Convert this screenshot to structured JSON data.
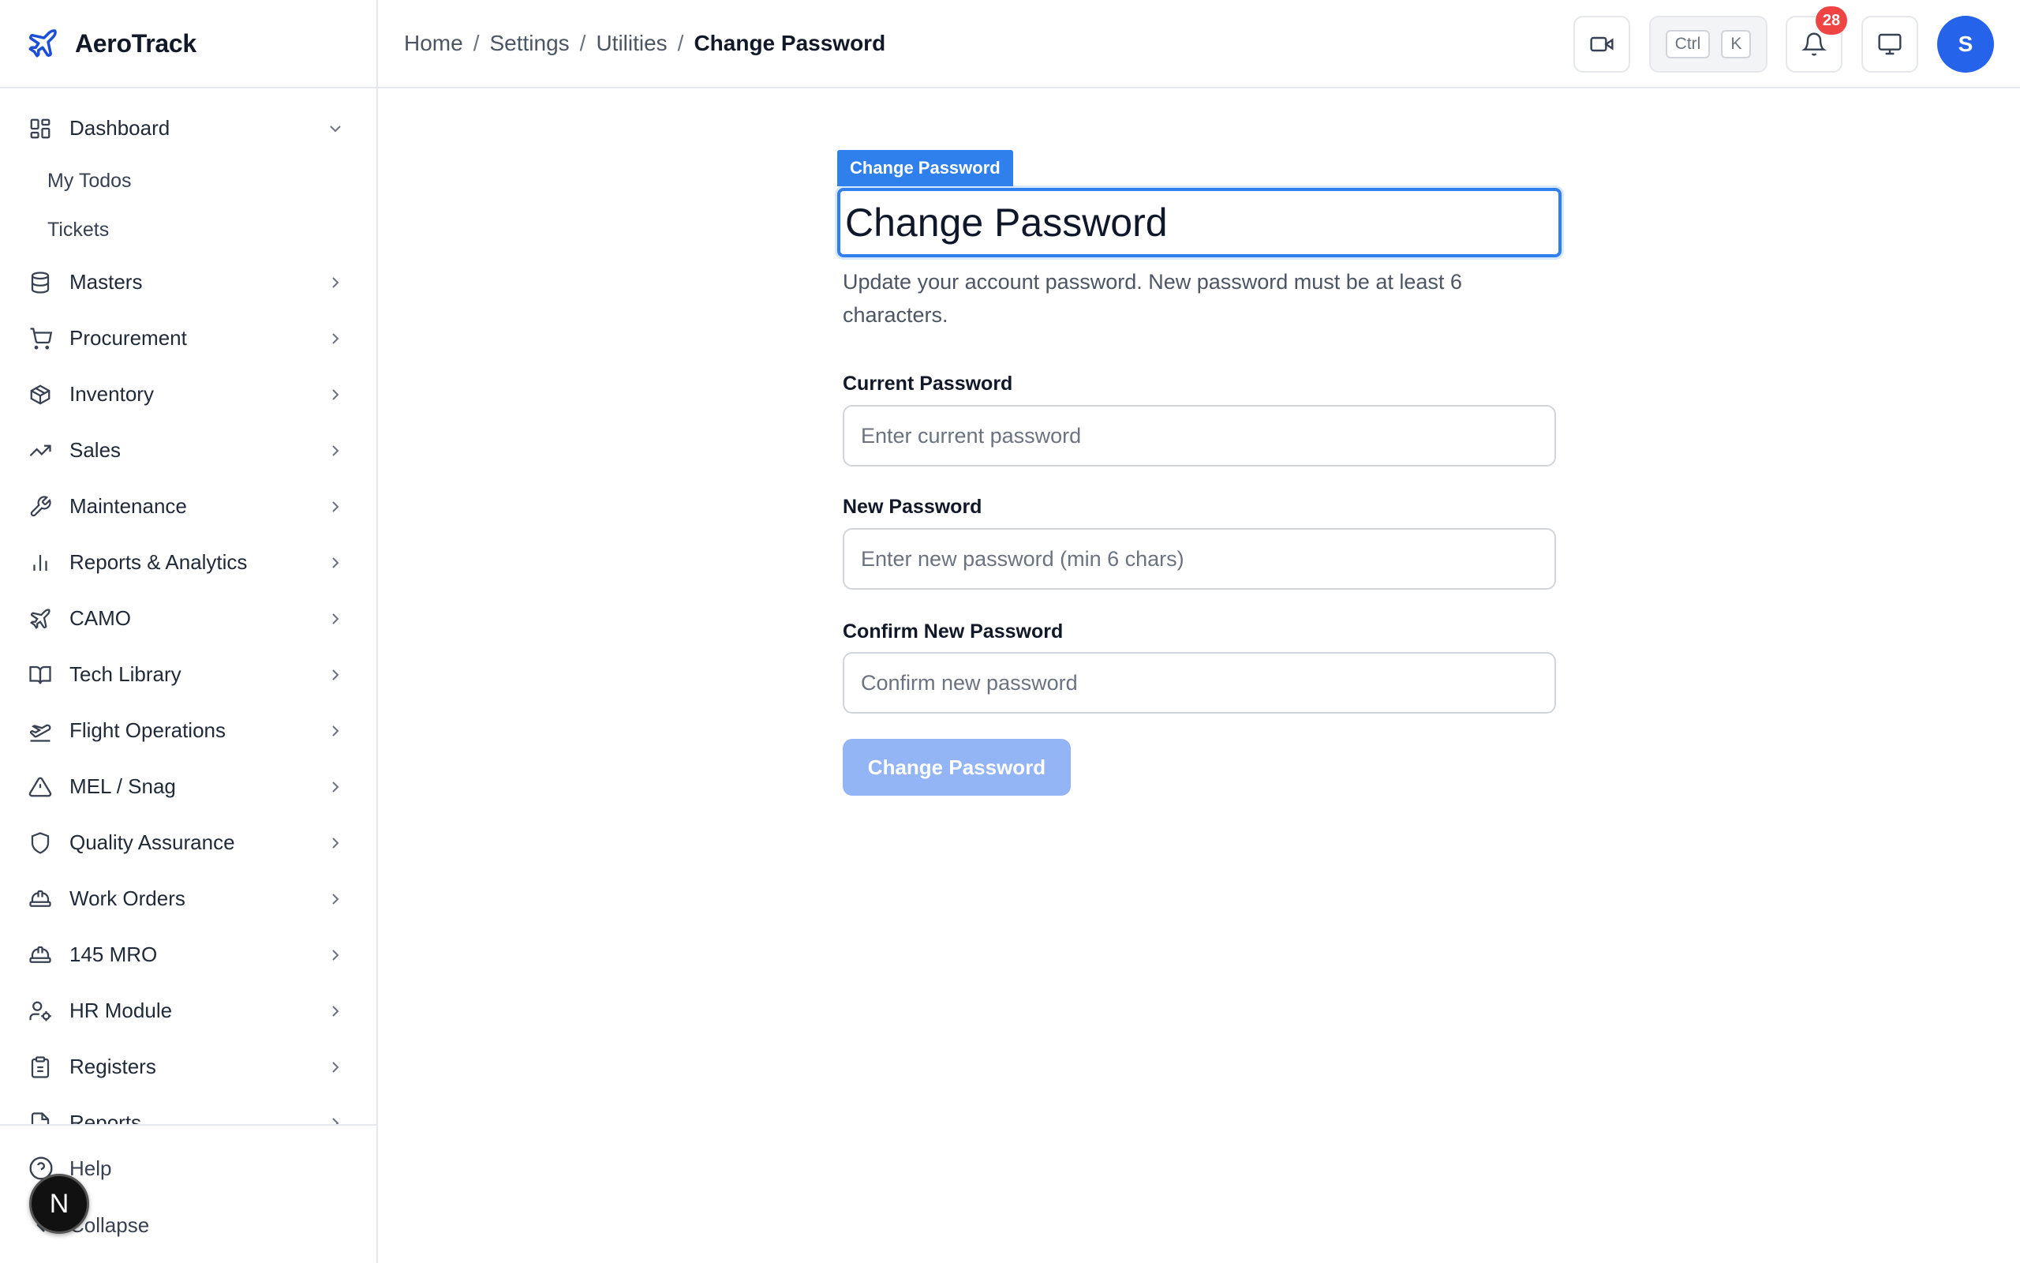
{
  "app": {
    "name": "AeroTrack",
    "accent_color": "#2f80ed",
    "brand_color": "#1d4ed8"
  },
  "sidebar": {
    "dashboard": {
      "label": "Dashboard",
      "icon": "dashboard-grid-icon",
      "expanded": true,
      "children": [
        {
          "label": "My Todos"
        },
        {
          "label": "Tickets"
        }
      ]
    },
    "items": [
      {
        "label": "Masters",
        "icon": "database-icon"
      },
      {
        "label": "Procurement",
        "icon": "cart-icon"
      },
      {
        "label": "Inventory",
        "icon": "package-icon"
      },
      {
        "label": "Sales",
        "icon": "trending-up-icon"
      },
      {
        "label": "Maintenance",
        "icon": "wrench-icon"
      },
      {
        "label": "Reports & Analytics",
        "icon": "bar-chart-icon"
      },
      {
        "label": "CAMO",
        "icon": "plane-icon"
      },
      {
        "label": "Tech Library",
        "icon": "book-icon"
      },
      {
        "label": "Flight Operations",
        "icon": "plane-takeoff-icon"
      },
      {
        "label": "MEL / Snag",
        "icon": "warning-triangle-icon"
      },
      {
        "label": "Quality Assurance",
        "icon": "shield-icon"
      },
      {
        "label": "Work Orders",
        "icon": "hard-hat-icon"
      },
      {
        "label": "145 MRO",
        "icon": "hard-hat-icon"
      },
      {
        "label": "HR Module",
        "icon": "user-cog-icon"
      },
      {
        "label": "Registers",
        "icon": "clipboard-icon"
      },
      {
        "label": "Reports",
        "icon": "file-icon"
      }
    ],
    "footer": {
      "help": "Help",
      "collapse": "Collapse",
      "n_badge": "N"
    }
  },
  "header": {
    "breadcrumb": [
      "Home",
      "Settings",
      "Utilities",
      "Change Password"
    ],
    "separator": "/",
    "shortcut": {
      "key1": "Ctrl",
      "key2": "K"
    },
    "notifications_count": "28",
    "avatar_initial": "S"
  },
  "form": {
    "tag_label": "Change Password",
    "title": "Change Password",
    "description": "Update your account password. New password must be at least 6 characters.",
    "fields": [
      {
        "label": "Current Password",
        "placeholder": "Enter current password",
        "value": ""
      },
      {
        "label": "New Password",
        "placeholder": "Enter new password (min 6 chars)",
        "value": ""
      },
      {
        "label": "Confirm New Password",
        "placeholder": "Confirm new password",
        "value": ""
      }
    ],
    "submit_label": "Change Password"
  }
}
